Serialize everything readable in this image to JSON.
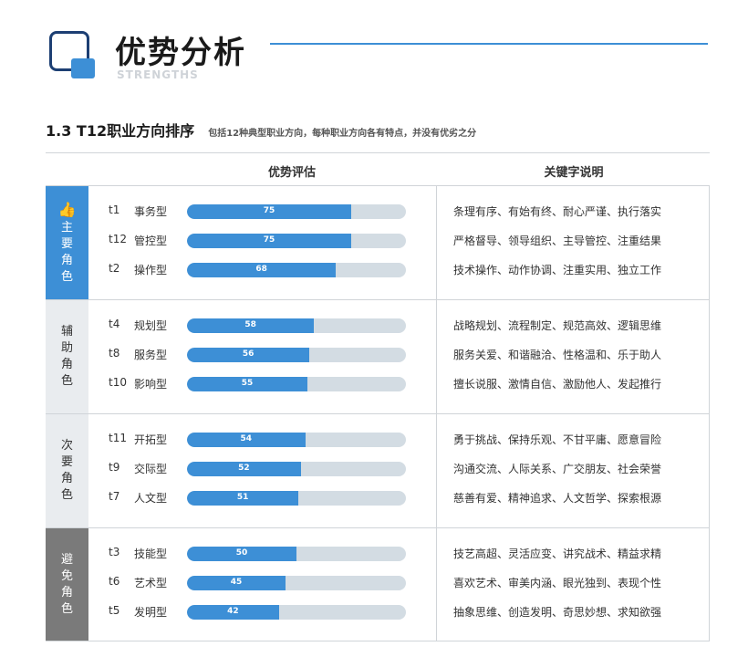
{
  "header": {
    "title": "优势分析",
    "subtitle": "STRENGTHS"
  },
  "section": {
    "title": "1.3 T12职业方向排序",
    "note": "包括12种典型职业方向，每种职业方向各有特点，并没有优劣之分"
  },
  "table": {
    "col_left": "优势评估",
    "col_right": "关键字说明",
    "groups": [
      {
        "label": "主要角色",
        "bg": "#3d8fd6",
        "fg": "#ffffff",
        "icon": "thumbs-up-icon",
        "rows": [
          {
            "code": "t1",
            "name": "事务型",
            "value": 75,
            "keywords": "条理有序、有始有终、耐心严谨、执行落实"
          },
          {
            "code": "t12",
            "name": "管控型",
            "value": 75,
            "keywords": "严格督导、领导组织、主导管控、注重结果"
          },
          {
            "code": "t2",
            "name": "操作型",
            "value": 68,
            "keywords": "技术操作、动作协调、注重实用、独立工作"
          }
        ]
      },
      {
        "label": "辅助角色",
        "bg": "#e9ecef",
        "fg": "#333333",
        "icon": "",
        "rows": [
          {
            "code": "t4",
            "name": "规划型",
            "value": 58,
            "keywords": "战略规划、流程制定、规范高效、逻辑思维"
          },
          {
            "code": "t8",
            "name": "服务型",
            "value": 56,
            "keywords": "服务关爱、和谐融洽、性格温和、乐于助人"
          },
          {
            "code": "t10",
            "name": "影响型",
            "value": 55,
            "keywords": "擅长说服、激情自信、激励他人、发起推行"
          }
        ]
      },
      {
        "label": "次要角色",
        "bg": "#e9ecef",
        "fg": "#333333",
        "icon": "",
        "rows": [
          {
            "code": "t11",
            "name": "开拓型",
            "value": 54,
            "keywords": "勇于挑战、保持乐观、不甘平庸、愿意冒险"
          },
          {
            "code": "t9",
            "name": "交际型",
            "value": 52,
            "keywords": "沟通交流、人际关系、广交朋友、社会荣誉"
          },
          {
            "code": "t7",
            "name": "人文型",
            "value": 51,
            "keywords": "慈善有爱、精神追求、人文哲学、探索根源"
          }
        ]
      },
      {
        "label": "避免角色",
        "bg": "#7a7a7a",
        "fg": "#ffffff",
        "icon": "",
        "rows": [
          {
            "code": "t3",
            "name": "技能型",
            "value": 50,
            "keywords": "技艺高超、灵活应变、讲究战术、精益求精"
          },
          {
            "code": "t6",
            "name": "艺术型",
            "value": 45,
            "keywords": "喜欢艺术、审美内涵、眼光独到、表现个性"
          },
          {
            "code": "t5",
            "name": "发明型",
            "value": 42,
            "keywords": "抽象思维、创造发明、奇思妙想、求知欲强"
          }
        ]
      }
    ]
  },
  "colors": {
    "accent": "#3d8fd6",
    "bar_track": "#d3dce3",
    "navy": "#1d3f73"
  }
}
